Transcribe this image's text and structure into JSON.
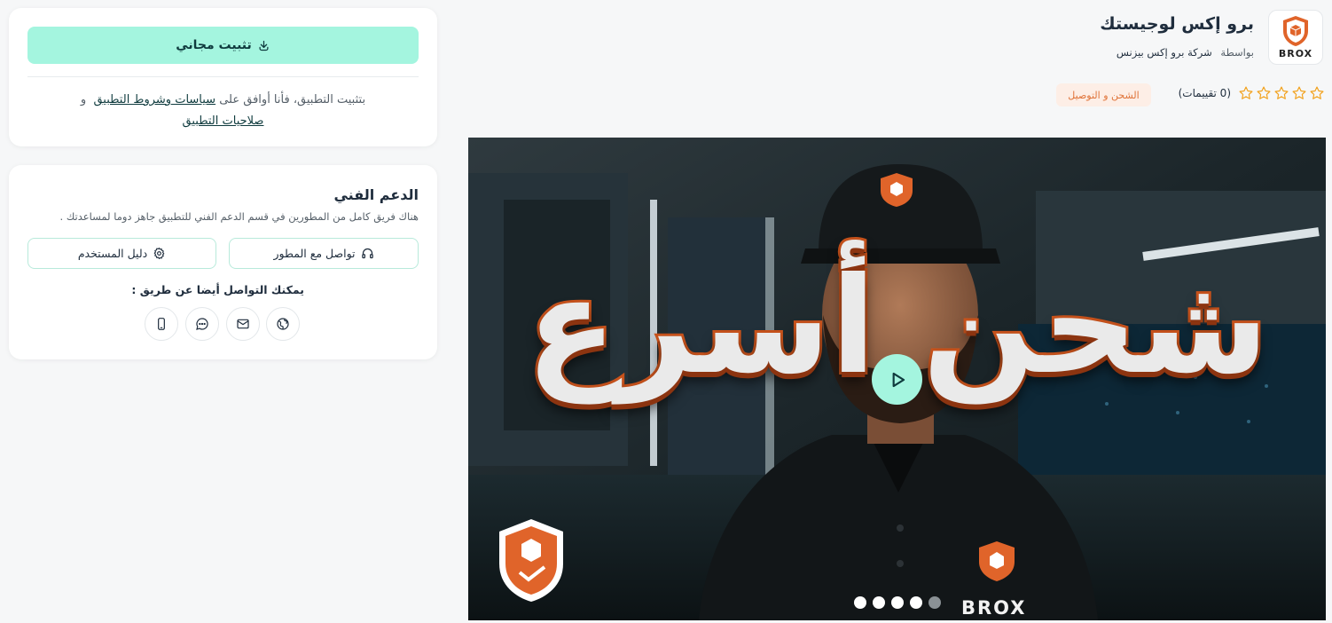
{
  "install": {
    "button_label": "تثبيت مجاني",
    "terms_prefix": "بتثبيت التطبيق، فأنا أوافق على",
    "terms_link": "سياسات وشروط التطبيق",
    "terms_and": "و",
    "permissions_link": "صلاحيات التطبيق"
  },
  "support": {
    "title": "الدعم الفني",
    "description": "هناك فريق كامل من المطورين في قسم الدعم الفني للتطبيق جاهز دوما لمساعدتك .",
    "contact_developer_label": "تواصل مع المطور",
    "user_guide_label": "دليل المستخدم",
    "also_contact_label": "يمكنك التواصل أيضا عن طريق :",
    "contact_icons": [
      "website-icon",
      "email-icon",
      "chat-icon",
      "phone-icon"
    ]
  },
  "app": {
    "title": "برو إكس لوجيستك",
    "by_label": "بواسطة",
    "developer": "شركة برو إكس بيزنس",
    "logo_text": "BROX",
    "rating_stars": 0,
    "rating_max": 5,
    "rating_count_text": "(0 تقييمات)",
    "category": "الشحن و التوصيل"
  },
  "media": {
    "headline": "شحن أسرع",
    "watermark": "BROX",
    "slides": 5,
    "active_slide": 5
  },
  "colors": {
    "accent": "#a4f5df",
    "category_bg": "#fdeee6",
    "category_text": "#e0743a",
    "brand_orange": "#e0642a"
  }
}
